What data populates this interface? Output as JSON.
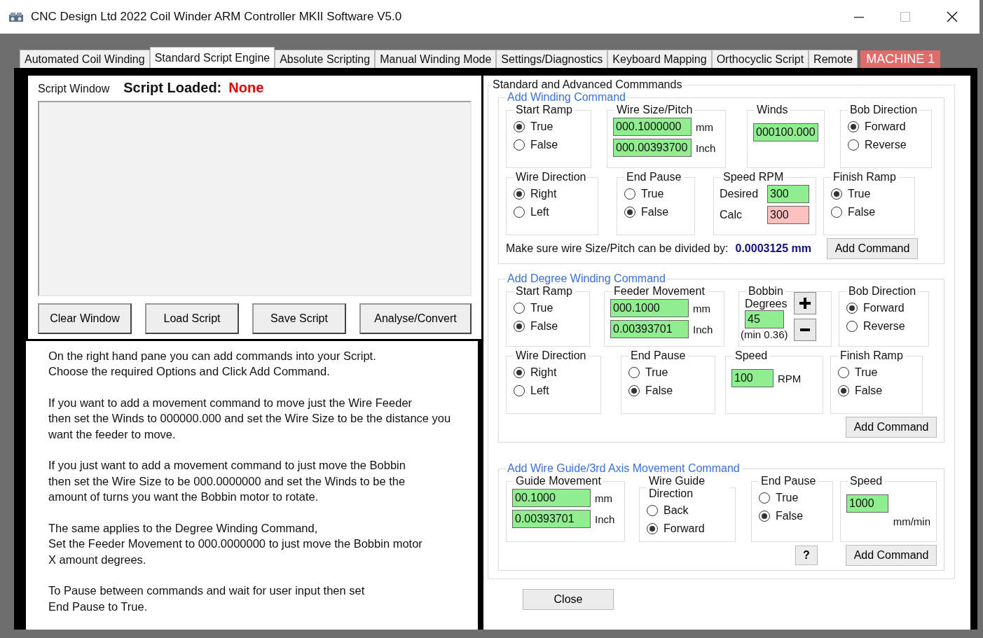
{
  "window": {
    "title": "CNC Design Ltd 2022 Coil Winder ARM Controller MKII Software V5.0"
  },
  "tabs": [
    {
      "label": "Automated Coil Winding",
      "selected": false
    },
    {
      "label": "Standard Script Engine",
      "selected": true
    },
    {
      "label": "Absolute Scripting",
      "selected": false
    },
    {
      "label": "Manual Winding Mode",
      "selected": false
    },
    {
      "label": "Settings/Diagnostics",
      "selected": false
    },
    {
      "label": "Keyboard Mapping",
      "selected": false
    },
    {
      "label": "Orthocyclic Script",
      "selected": false
    },
    {
      "label": "Remote",
      "selected": false
    }
  ],
  "machine_badge": "MACHINE 1",
  "script_panel": {
    "title": "Script Window",
    "loaded_label": "Script Loaded:",
    "loaded_value": "None",
    "buttons": [
      "Clear Window",
      "Load Script",
      "Save Script",
      "Analyse/Convert"
    ]
  },
  "help_paragraphs": [
    [
      "On the right hand pane you can add commands into your Script.",
      "Choose the required Options and Click Add Command."
    ],
    [
      "If you want to add a movement command to move just the Wire Feeder",
      "then set the Winds to 000000.000 and set the Wire Size to be the distance you",
      "want the feeder to move."
    ],
    [
      "If you just want to add a movement command to just move the Bobbin",
      "then set the Wire Size to be 000.0000000 and set the Winds to be the",
      "amount of turns you want the Bobbin motor to rotate."
    ],
    [
      "The same applies to the Degree Winding Command,",
      "Set the Feeder Movement to 000.0000000 to just move the Bobbin motor",
      "X amount degrees."
    ],
    [
      "To Pause between commands and wait for user input then set",
      "End Pause to True."
    ]
  ],
  "commands": {
    "title": "Standard and Advanced Commmands",
    "sections": [
      {
        "legend": "Add Winding Command",
        "rows": [
          [
            {
              "kind": "radio",
              "title": "Start Ramp",
              "options": [
                {
                  "label": "True",
                  "selected": true
                },
                {
                  "label": "False",
                  "selected": false
                }
              ]
            },
            {
              "kind": "inputs",
              "title": "Wire Size/Pitch",
              "inputs": [
                {
                  "value": "000.1000000",
                  "unit": "mm",
                  "color": "#90ee90"
                },
                {
                  "value": "000.00393700",
                  "unit": "Inch",
                  "color": "#90ee90"
                }
              ]
            },
            {
              "kind": "inputs",
              "title": "Winds",
              "inputs": [
                {
                  "value": "000100.000",
                  "color": "#90ee90"
                }
              ]
            },
            {
              "kind": "radio",
              "title": "Bob Direction",
              "options": [
                {
                  "label": "Forward",
                  "selected": true
                },
                {
                  "label": "Reverse",
                  "selected": false
                }
              ]
            }
          ],
          [
            {
              "kind": "radio",
              "title": "Wire Direction",
              "options": [
                {
                  "label": "Right",
                  "selected": true
                },
                {
                  "label": "Left",
                  "selected": false
                }
              ]
            },
            {
              "kind": "radio",
              "title": "End Pause",
              "options": [
                {
                  "label": "True",
                  "selected": false
                },
                {
                  "label": "False",
                  "selected": true
                }
              ]
            },
            {
              "kind": "inputs",
              "title": "Speed RPM",
              "inputs": [
                {
                  "label": "Desired",
                  "value": "300",
                  "color": "#90ee90"
                },
                {
                  "label": "Calc",
                  "value": "300",
                  "color": "#ffc0c0"
                }
              ]
            },
            {
              "kind": "radio",
              "title": "Finish Ramp",
              "options": [
                {
                  "label": "True",
                  "selected": true
                },
                {
                  "label": "False",
                  "selected": false
                }
              ]
            }
          ]
        ],
        "note": "Make sure wire Size/Pitch can be divided by:",
        "note_value": "0.0003125 mm",
        "add_button": "Add Command"
      },
      {
        "legend": "Add Degree Winding Command",
        "rows": [
          [
            {
              "kind": "radio",
              "title": "Start Ramp",
              "options": [
                {
                  "label": "True",
                  "selected": false
                },
                {
                  "label": "False",
                  "selected": true
                }
              ]
            },
            {
              "kind": "inputs",
              "title": "Feeder Movement",
              "inputs": [
                {
                  "value": "000.1000",
                  "unit": "mm",
                  "color": "#90ee90"
                },
                {
                  "value": "0.00393701",
                  "unit": "Inch",
                  "color": "#90ee90"
                }
              ]
            },
            {
              "kind": "degrees",
              "title": "Bobbin",
              "subtitle": "Degrees",
              "value": "45",
              "color": "#90ee90",
              "hint": "(min 0.36)"
            },
            {
              "kind": "radio",
              "title": "Bob Direction",
              "options": [
                {
                  "label": "Forward",
                  "selected": true
                },
                {
                  "label": "Reverse",
                  "selected": false
                }
              ]
            }
          ],
          [
            {
              "kind": "radio",
              "title": "Wire Direction",
              "options": [
                {
                  "label": "Right",
                  "selected": true
                },
                {
                  "label": "Left",
                  "selected": false
                }
              ]
            },
            {
              "kind": "radio",
              "title": "End Pause",
              "options": [
                {
                  "label": "True",
                  "selected": false
                },
                {
                  "label": "False",
                  "selected": true
                }
              ]
            },
            {
              "kind": "inputs",
              "title": "Speed",
              "inputs": [
                {
                  "value": "100",
                  "unit": "RPM",
                  "color": "#90ee90"
                }
              ]
            },
            {
              "kind": "radio",
              "title": "Finish Ramp",
              "options": [
                {
                  "label": "True",
                  "selected": false
                },
                {
                  "label": "False",
                  "selected": true
                }
              ]
            }
          ]
        ],
        "add_button": "Add Command"
      },
      {
        "legend": "Add Wire Guide/3rd Axis Movement Command",
        "rows": [
          [
            {
              "kind": "inputs",
              "title": "Guide Movement",
              "inputs": [
                {
                  "value": "00.1000",
                  "unit": "mm",
                  "color": "#90ee90"
                },
                {
                  "value": "0.00393701",
                  "unit": "Inch",
                  "color": "#90ee90"
                }
              ]
            },
            {
              "kind": "radio",
              "title": "Wire Guide Direction",
              "options": [
                {
                  "label": "Back",
                  "selected": false
                },
                {
                  "label": "Forward",
                  "selected": true
                }
              ]
            },
            {
              "kind": "radio",
              "title": "End Pause",
              "options": [
                {
                  "label": "True",
                  "selected": false
                },
                {
                  "label": "False",
                  "selected": true
                }
              ]
            },
            {
              "kind": "inputs",
              "title": "Speed",
              "inputs": [
                {
                  "value": "1000",
                  "color": "#90ee90"
                }
              ],
              "unit": "mm/min"
            }
          ]
        ],
        "help_button": "?",
        "add_button": "Add Command"
      }
    ],
    "close_button": "Close"
  }
}
